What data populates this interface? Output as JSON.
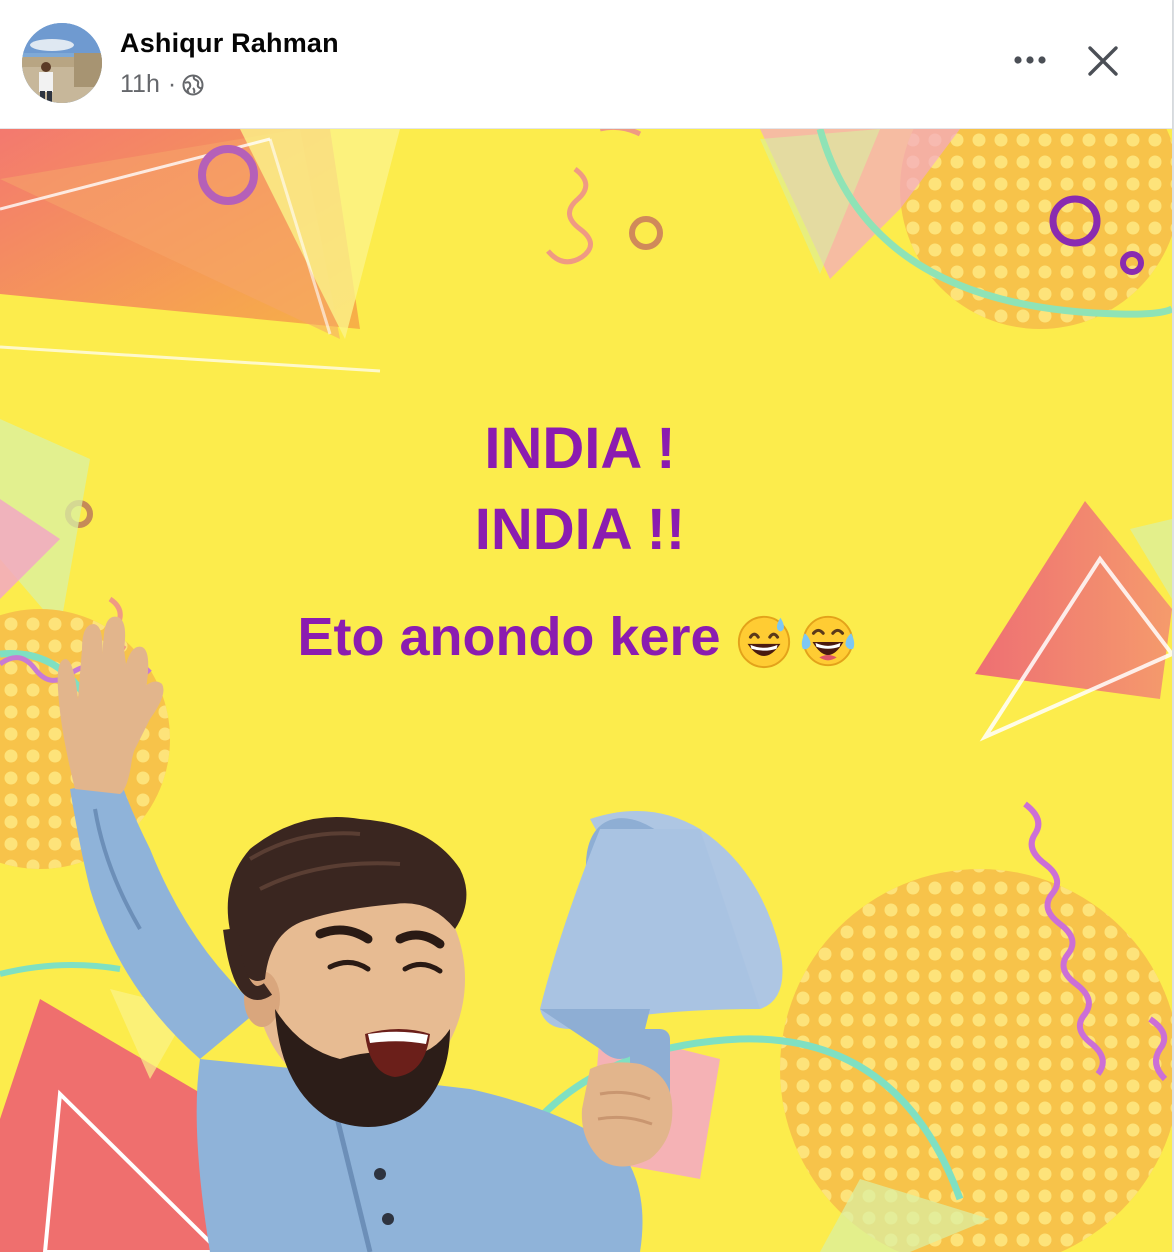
{
  "post": {
    "author_name": "Ashiqur Rahman",
    "timestamp": "11h",
    "separator": "·",
    "privacy_icon": "globe-icon",
    "more_icon": "more-options-icon",
    "close_icon": "close-icon"
  },
  "content": {
    "line1": "INDIA !",
    "line2": "INDIA !!",
    "line3": "Eto anondo kere",
    "emojis": [
      "grinning-sweat-emoji",
      "tears-of-joy-emoji"
    ]
  },
  "colors": {
    "background_yellow": "#fcec4c",
    "headline_purple": "#8b1cb0",
    "name_text": "#050505",
    "meta_text": "#65676b"
  }
}
